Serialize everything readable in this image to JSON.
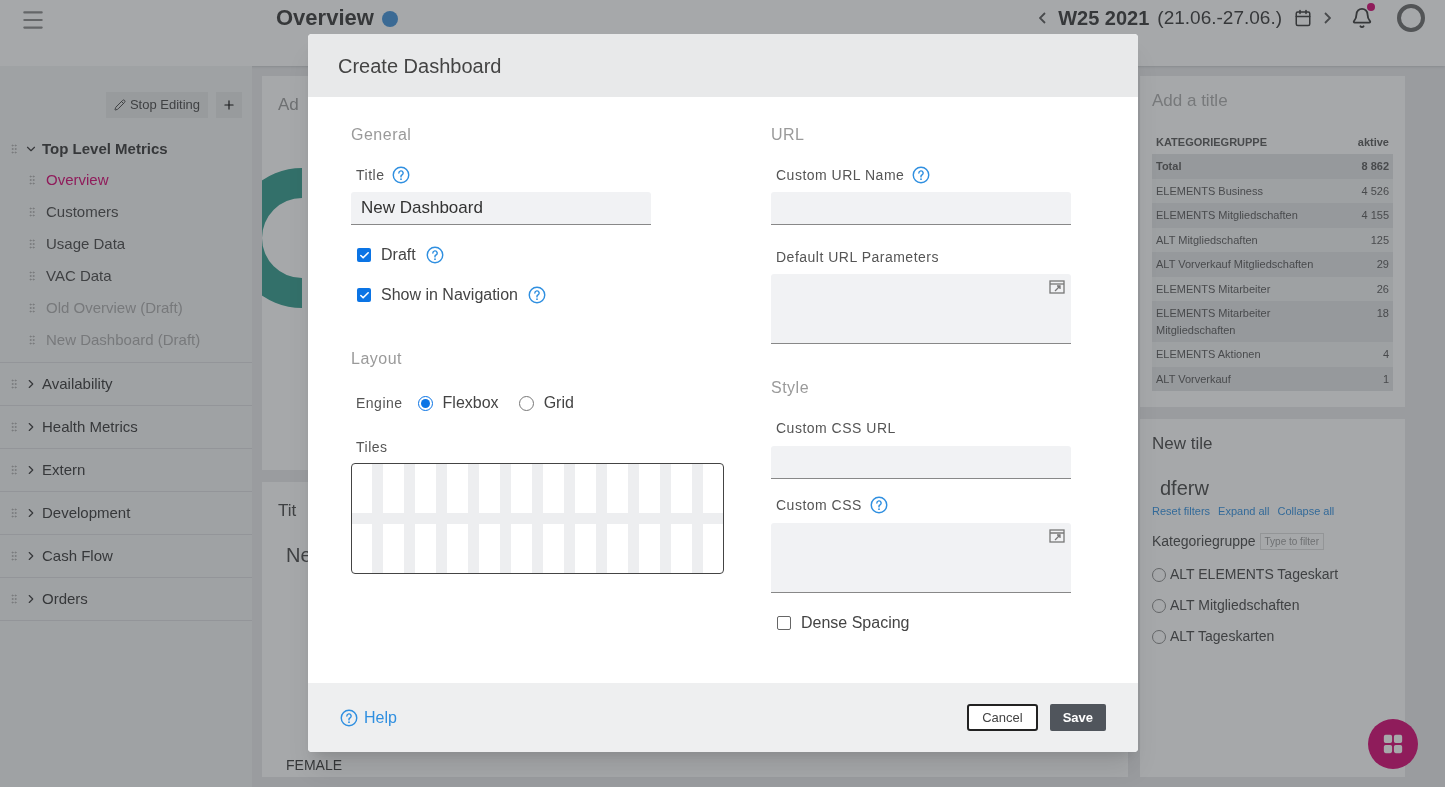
{
  "header": {
    "title": "Overview",
    "week": "W25 2021",
    "range": "(21.06.-27.06.)",
    "notification": true
  },
  "sidebar": {
    "stop_editing": "Stop Editing",
    "groups": [
      {
        "label": "Top Level Metrics",
        "expanded": true,
        "children": [
          {
            "label": "Overview",
            "selected": true,
            "draft": false
          },
          {
            "label": "Customers",
            "selected": false,
            "draft": false
          },
          {
            "label": "Usage Data",
            "selected": false,
            "draft": false
          },
          {
            "label": "VAC Data",
            "selected": false,
            "draft": false
          },
          {
            "label": "Old Overview (Draft)",
            "selected": false,
            "draft": true
          },
          {
            "label": "New Dashboard (Draft)",
            "selected": false,
            "draft": true
          }
        ]
      },
      {
        "label": "Availability",
        "expanded": false
      },
      {
        "label": "Health Metrics",
        "expanded": false
      },
      {
        "label": "Extern",
        "expanded": false
      },
      {
        "label": "Development",
        "expanded": false
      },
      {
        "label": "Cash Flow",
        "expanded": false
      },
      {
        "label": "Orders",
        "expanded": false
      }
    ]
  },
  "middle_tiles": [
    {
      "title": "Ad"
    },
    {
      "title": "Tit",
      "subtitle": "Ne",
      "items": [
        "FEMALE"
      ]
    }
  ],
  "table_tile": {
    "title": "Add a title",
    "columns": [
      "KATEGORIEGRUPPE",
      "aktive"
    ],
    "rows": [
      {
        "cells": [
          "Total",
          "8 862"
        ],
        "kind": "total"
      },
      {
        "cells": [
          "ELEMENTS Business",
          "4 526"
        ],
        "kind": "row"
      },
      {
        "cells": [
          "ELEMENTS Mitgliedschaften",
          "4 155"
        ],
        "kind": "row"
      },
      {
        "cells": [
          "ALT Mitgliedschaften",
          "125"
        ],
        "kind": "row"
      },
      {
        "cells": [
          "ALT Vorverkauf Mitgliedschaften",
          "29"
        ],
        "kind": "row"
      },
      {
        "cells": [
          "ELEMENTS Mitarbeiter",
          "26"
        ],
        "kind": "row"
      },
      {
        "cells": [
          "ELEMENTS Mitarbeiter Mitgliedschaften",
          "18"
        ],
        "kind": "row"
      },
      {
        "cells": [
          "ELEMENTS Aktionen",
          "4"
        ],
        "kind": "row"
      },
      {
        "cells": [
          "ALT Vorverkauf",
          "1"
        ],
        "kind": "row"
      }
    ]
  },
  "filter_tile": {
    "title": "New tile",
    "subtitle": "dferw",
    "links": [
      "Reset filters",
      "Expand all",
      "Collapse all"
    ],
    "group": "Kategoriegruppe",
    "placeholder": "Type to filter",
    "items": [
      {
        "label": "ALT ELEMENTS Tageskart",
        "checked": false
      },
      {
        "label": "ALT Mitgliedschaften",
        "checked": false
      },
      {
        "label": "ALT Tageskarten",
        "checked": false
      }
    ]
  },
  "modal": {
    "title": "Create Dashboard",
    "general": {
      "heading": "General",
      "title_label": "Title",
      "title_value": "New Dashboard",
      "checkboxes": [
        {
          "label": "Draft",
          "checked": true,
          "help": true
        },
        {
          "label": "Show in Navigation",
          "checked": true,
          "help": true
        }
      ]
    },
    "layout": {
      "heading": "Layout",
      "engine_label": "Engine",
      "engines": [
        {
          "label": "Flexbox",
          "selected": true
        },
        {
          "label": "Grid",
          "selected": false
        }
      ],
      "tiles_label": "Tiles"
    },
    "url": {
      "heading": "URL",
      "fields": [
        {
          "label": "Custom URL Name",
          "help": true,
          "kind": "input"
        },
        {
          "label": "Default URL Parameters",
          "help": false,
          "kind": "textarea"
        }
      ]
    },
    "style": {
      "heading": "Style",
      "fields": [
        {
          "label": "Custom CSS URL",
          "help": false,
          "kind": "input"
        },
        {
          "label": "Custom CSS",
          "help": true,
          "kind": "textarea"
        }
      ],
      "checkbox": {
        "label": "Dense Spacing",
        "checked": false
      }
    },
    "footer": {
      "help": "Help",
      "cancel": "Cancel",
      "save": "Save"
    }
  }
}
